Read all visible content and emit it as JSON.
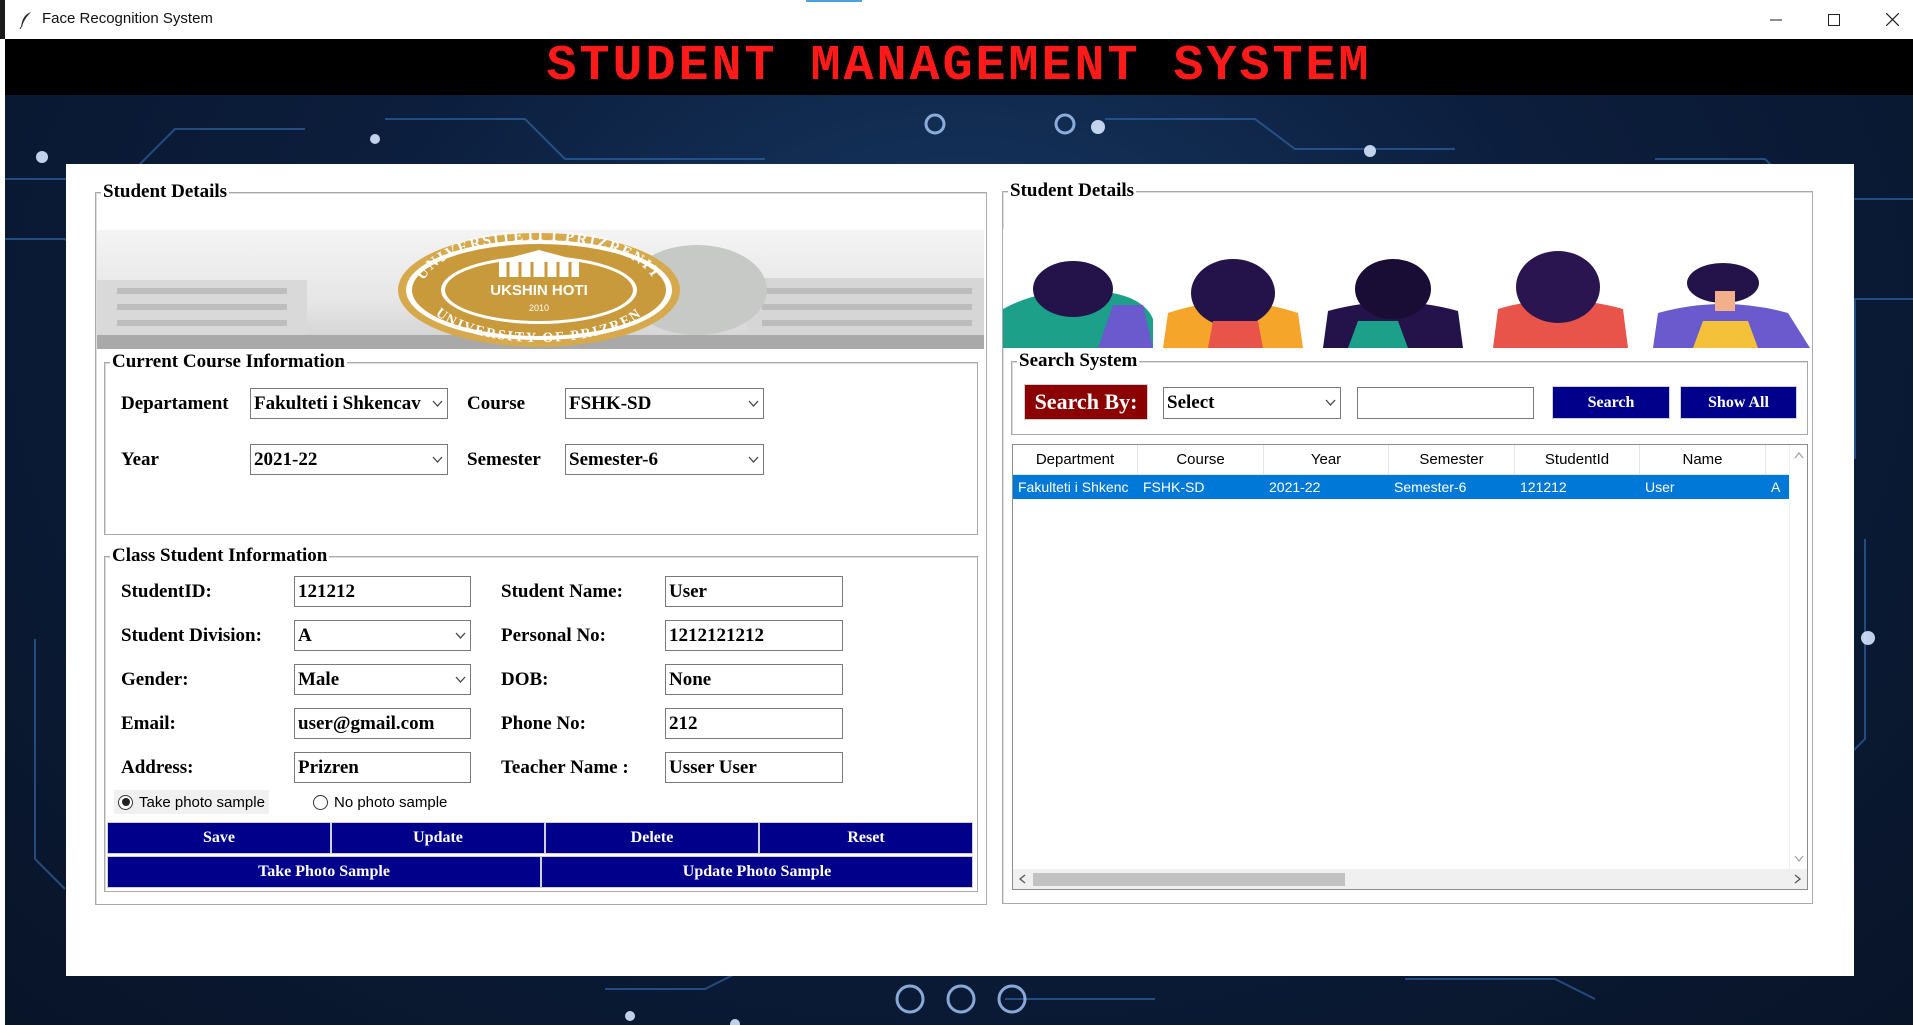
{
  "window": {
    "title": "Face Recognition System"
  },
  "header": {
    "title": "STUDENT MANAGEMENT SYSTEM"
  },
  "left_frame": {
    "title": "Student Details",
    "banner": {
      "seal_top_text": "UNIVERSITETI I PRIZRENIT",
      "seal_name": "UKSHIN HOTI",
      "seal_year": "2010",
      "seal_bottom_text": "UNIVERSITY OF PRIZREN"
    },
    "course": {
      "title": "Current Course Information",
      "department_label": "Departament",
      "department_value": "Fakulteti i Shkencav",
      "course_label": "Course",
      "course_value": "FSHK-SD",
      "year_label": "Year",
      "year_value": "2021-22",
      "semester_label": "Semester",
      "semester_value": "Semester-6"
    },
    "class_info": {
      "title": "Class Student Information",
      "student_id_label": "StudentID:",
      "student_id_value": "121212",
      "student_name_label": "Student Name:",
      "student_name_value": "User",
      "division_label": "Student Division:",
      "division_value": "A",
      "personal_no_label": "Personal No:",
      "personal_no_value": "1212121212",
      "gender_label": "Gender:",
      "gender_value": "Male",
      "dob_label": "DOB:",
      "dob_value": "None",
      "email_label": "Email:",
      "email_value": "user@gmail.com",
      "phone_label": "Phone No:",
      "phone_value": "212",
      "address_label": "Address:",
      "address_value": "Prizren",
      "teacher_label": "Teacher Name :",
      "teacher_value": "Usser User",
      "radio_take": "Take photo sample",
      "radio_no": "No photo sample"
    },
    "buttons": {
      "save": "Save",
      "update": "Update",
      "delete": "Delete",
      "reset": "Reset",
      "take_photo": "Take Photo Sample",
      "update_photo": "Update Photo Sample"
    }
  },
  "right_frame": {
    "title": "Student Details",
    "search": {
      "title": "Search System",
      "search_by_label": "Search By:",
      "select_value": "Select",
      "search_text": "",
      "search_button": "Search",
      "show_all_button": "Show All"
    },
    "table": {
      "columns": [
        "Department",
        "Course",
        "Year",
        "Semester",
        "StudentId",
        "Name"
      ],
      "rows": [
        [
          "Fakulteti i Shkenc",
          "FSHK-SD",
          "2021-22",
          "Semester-6",
          "121212",
          "User",
          "A"
        ]
      ]
    }
  },
  "colors": {
    "header_bg": "#000000",
    "header_text": "#ff1a1a",
    "button_navy": "#00008b",
    "search_by_bg": "#8b0000",
    "row_selected": "#0078d7"
  }
}
